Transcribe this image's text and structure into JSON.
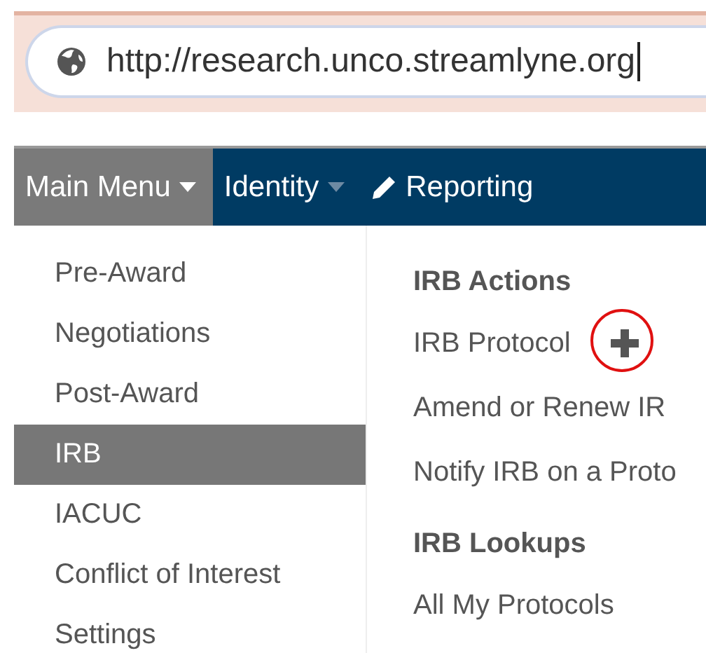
{
  "address_bar": {
    "url": "http://research.unco.streamlyne.org"
  },
  "nav": [
    {
      "label": "Main Menu",
      "kind": "dropdown",
      "selected": true
    },
    {
      "label": "Identity",
      "kind": "dropdown",
      "selected": false
    },
    {
      "label": "Reporting",
      "kind": "link",
      "selected": false
    }
  ],
  "sidebar": {
    "items": [
      {
        "label": "Pre-Award",
        "selected": false
      },
      {
        "label": "Negotiations",
        "selected": false
      },
      {
        "label": "Post-Award",
        "selected": false
      },
      {
        "label": "IRB",
        "selected": true
      },
      {
        "label": "IACUC",
        "selected": false
      },
      {
        "label": "Conflict of Interest",
        "selected": false
      },
      {
        "label": "Settings",
        "selected": false
      }
    ]
  },
  "panel": {
    "sections": [
      {
        "heading": "IRB Actions",
        "items": [
          {
            "label": "IRB Protocol",
            "add_button": true,
            "circled": true
          },
          {
            "label": "Amend or Renew IR",
            "add_button": false
          },
          {
            "label": "Notify IRB on a Proto",
            "add_button": false
          }
        ]
      },
      {
        "heading": "IRB Lookups",
        "items": [
          {
            "label": "All My Protocols",
            "add_button": false
          }
        ]
      }
    ]
  }
}
